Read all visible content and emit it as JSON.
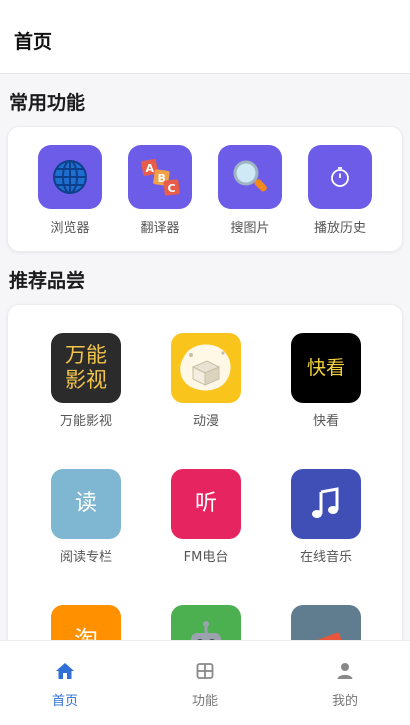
{
  "header": {
    "title": "首页"
  },
  "common": {
    "title": "常用功能",
    "items": [
      {
        "label": "浏览器",
        "icon": "globe-icon"
      },
      {
        "label": "翻译器",
        "icon": "abc-blocks-icon"
      },
      {
        "label": "搜图片",
        "icon": "magnifier-icon"
      },
      {
        "label": "播放历史",
        "icon": "stopwatch-icon"
      }
    ]
  },
  "recommend": {
    "title": "推荐品尝",
    "items": [
      {
        "label": "万能影视",
        "icon_text": "万能\n影视",
        "color": "#2b2b2b",
        "text_color": "#f3c54a"
      },
      {
        "label": "动漫",
        "icon": "anime-icon",
        "color": "#f9c41c"
      },
      {
        "label": "快看",
        "icon_text": "快看",
        "color": "#000000",
        "text_color": "#f4d23c"
      },
      {
        "label": "阅读专栏",
        "icon_text": "读",
        "color": "#7fb6d2",
        "text_color": "#ffffff"
      },
      {
        "label": "FM电台",
        "icon_text": "听",
        "color": "#e6245f",
        "text_color": "#ffffff"
      },
      {
        "label": "在线音乐",
        "icon": "music-note-icon",
        "color": "#3f4fb5"
      },
      {
        "icon_text": "淘",
        "color": "#ff9000",
        "text_color": "#ffffff"
      },
      {
        "icon": "robot-icon",
        "color": "#4caf50"
      },
      {
        "icon": "books-icon",
        "color": "#5f7d8f"
      }
    ]
  },
  "nav": {
    "items": [
      {
        "label": "首页",
        "icon": "home-icon",
        "active": true
      },
      {
        "label": "功能",
        "icon": "grid-icon",
        "active": false
      },
      {
        "label": "我的",
        "icon": "person-icon",
        "active": false
      }
    ]
  },
  "colors": {
    "accent": "#2f6fd6",
    "function_icon_bg": "#6c5ce7"
  }
}
